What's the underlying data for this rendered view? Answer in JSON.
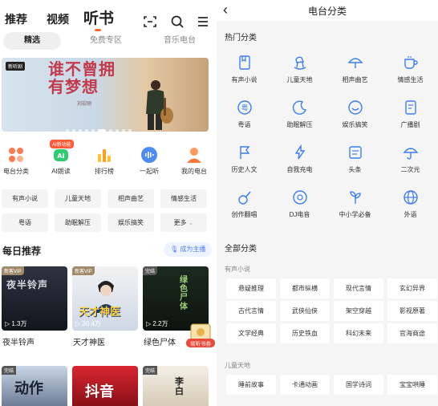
{
  "left": {
    "top_tabs": [
      "推荐",
      "视频",
      "听书"
    ],
    "sub_tabs": [
      "精选",
      "免费专区",
      "音乐电台"
    ],
    "banner": {
      "logo": "新听剧",
      "title": "谁不曾拥有梦想",
      "author": "刘宏刚"
    },
    "quick_entries": [
      {
        "label": "电台分类",
        "icon": "grid-icon"
      },
      {
        "label": "AI朗读",
        "icon": "ai-icon",
        "badge": "AI新功能"
      },
      {
        "label": "排行榜",
        "icon": "bar-chart-icon"
      },
      {
        "label": "一起听",
        "icon": "voice-icon"
      },
      {
        "label": "我的电台",
        "icon": "person-icon"
      }
    ],
    "chips": [
      "有声小说",
      "儿童天地",
      "相声曲艺",
      "情感生活",
      "粤语",
      "助眠解压",
      "娱乐搞笑",
      "更多"
    ],
    "daily": {
      "title": "每日推荐",
      "host_button": "成为主播"
    },
    "cards": [
      {
        "name": "夜半铃声",
        "plays": "1.3万",
        "badge": "新客VIP",
        "cover_text": "夜半铃声"
      },
      {
        "name": "天才神医",
        "plays": "30.4万",
        "badge": "新客VIP",
        "cover_text": "天才神医"
      },
      {
        "name": "绿色尸体",
        "plays": "2.2万",
        "badge": "完结",
        "cover_text": "绿色尸体"
      }
    ],
    "cards_row2": [
      {
        "badge": "完结",
        "cover_text": "动作"
      },
      {
        "badge": "",
        "cover_text": "抖音"
      },
      {
        "badge": "完结",
        "cover_text": "李白"
      }
    ],
    "float_badge": "领听书券"
  },
  "right": {
    "title": "电台分类",
    "hot_section": "热门分类",
    "hot": [
      {
        "label": "有声小说",
        "icon": "book-icon"
      },
      {
        "label": "儿童天地",
        "icon": "rocking-horse-icon"
      },
      {
        "label": "相声曲艺",
        "icon": "fan-icon"
      },
      {
        "label": "情感生活",
        "icon": "cup-icon"
      },
      {
        "label": "粤语",
        "icon": "cantonese-icon"
      },
      {
        "label": "助眠解压",
        "icon": "moon-icon"
      },
      {
        "label": "娱乐搞笑",
        "icon": "smile-icon"
      },
      {
        "label": "广播剧",
        "icon": "script-icon"
      },
      {
        "label": "历史人文",
        "icon": "flag-icon"
      },
      {
        "label": "自我充电",
        "icon": "lightning-icon"
      },
      {
        "label": "头条",
        "icon": "news-icon"
      },
      {
        "label": "二次元",
        "icon": "umbrella-icon"
      },
      {
        "label": "创作翻唱",
        "icon": "guitar-icon"
      },
      {
        "label": "DJ电音",
        "icon": "dj-icon"
      },
      {
        "label": "中小学必备",
        "icon": "sprout-icon"
      },
      {
        "label": "外语",
        "icon": "globe-icon"
      }
    ],
    "all_section": "全部分类",
    "groups": [
      {
        "title": "有声小说",
        "items": [
          "悬疑推理",
          "都市纵横",
          "现代言情",
          "玄幻异界",
          "古代言情",
          "武侠仙侠",
          "架空穿越",
          "影视原著",
          "文学经典",
          "历史铁血",
          "科幻未来",
          "官海商途"
        ]
      },
      {
        "title": "儿童天地",
        "items": [
          "睡前故事",
          "卡通动画",
          "国学诗词",
          "宝宝哄睡"
        ]
      }
    ]
  }
}
